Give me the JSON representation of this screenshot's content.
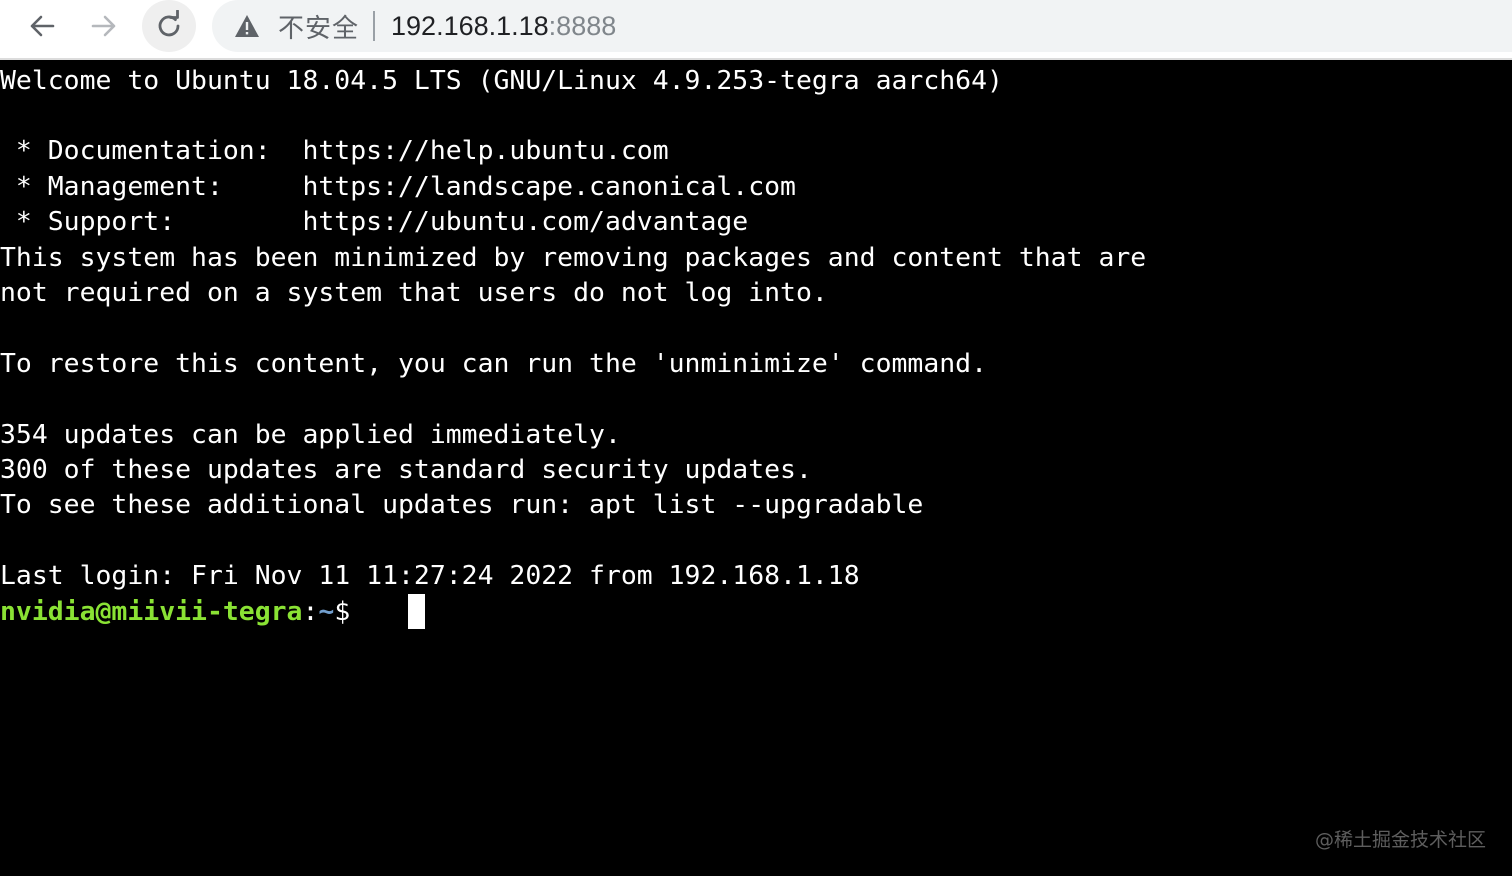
{
  "browser": {
    "back_icon": "back-arrow-icon",
    "forward_icon": "forward-arrow-icon",
    "reload_icon": "reload-icon",
    "security_icon": "warning-triangle-icon",
    "security_label": "不安全",
    "url_host": "192.168.1.18",
    "url_port": ":8888"
  },
  "terminal": {
    "lines": [
      "Welcome to Ubuntu 18.04.5 LTS (GNU/Linux 4.9.253-tegra aarch64)",
      "",
      " * Documentation:  https://help.ubuntu.com",
      " * Management:     https://landscape.canonical.com",
      " * Support:        https://ubuntu.com/advantage",
      "This system has been minimized by removing packages and content that are",
      "not required on a system that users do not log into.",
      "",
      "To restore this content, you can run the 'unminimize' command.",
      "",
      "354 updates can be applied immediately.",
      "300 of these updates are standard security updates.",
      "To see these additional updates run: apt list --upgradable",
      "",
      "Last login: Fri Nov 11 11:27:24 2022 from 192.168.1.18"
    ],
    "prompt": {
      "user_host": "nvidia@miivii-tegra",
      "colon": ":",
      "path": "~",
      "symbol": "$ "
    }
  },
  "watermark": "@稀土掘金技术社区",
  "colors": {
    "prompt_user": "#8ae234",
    "prompt_path": "#729fcf",
    "terminal_bg": "#000000",
    "terminal_fg": "#ffffff"
  }
}
